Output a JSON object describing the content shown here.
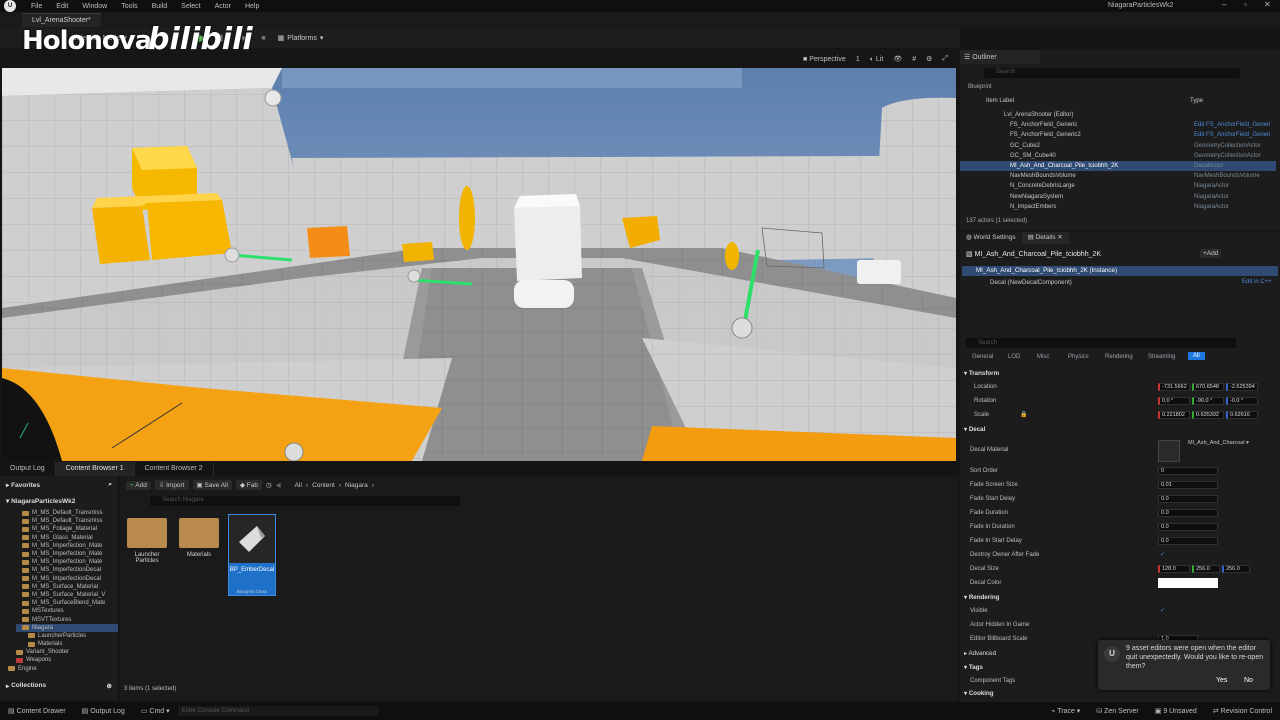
{
  "menubar": {
    "items": [
      "File",
      "Edit",
      "Window",
      "Tools",
      "Build",
      "Select",
      "Actor",
      "Help"
    ],
    "app_title": "NiagaraParticlesWk2"
  },
  "doc_tab": "Lvl_ArenaShooter*",
  "watermark": {
    "text1": "Holonova",
    "text2": "bilibili"
  },
  "toolbar": {
    "selection_mode": "Selection Mode",
    "platforms": "Platforms"
  },
  "viewport_bar": {
    "perspective": "Perspective",
    "lit": "Lit",
    "num": "1"
  },
  "lower_tabs": [
    "Output Log",
    "Content Browser 1",
    "Content Browser 2"
  ],
  "content_browser": {
    "add": "Add",
    "import": "Import",
    "save_all": "Save All",
    "fab": "Fab",
    "path": [
      "All",
      "Content",
      "Niagara"
    ],
    "search_placeholder": "Search Niagara",
    "favorites": "Favorites",
    "project": "NiagaraParticlesWk2",
    "tree": [
      "M_MS_Default_Transmiss",
      "M_MS_Default_Transmiss",
      "M_MS_Foliage_Material",
      "M_MS_Glass_Material",
      "M_MS_Imperfection_Mate",
      "M_MS_Imperfection_Mate",
      "M_MS_Imperfection_Mate",
      "M_MS_ImperfectionDecal",
      "M_MS_ImperfectionDecal",
      "M_MS_Surface_Material",
      "M_MS_Surface_Material_V",
      "M_MS_SurfaceBlend_Mate",
      "MSTextures",
      "MSVTTextures",
      "Niagara",
      "LauncherParticles",
      "Materials",
      "Variant_Shooter",
      "Weapons",
      "Engine"
    ],
    "collections": "Collections",
    "assets": [
      {
        "name": "Launcher Particles",
        "kind": "folder"
      },
      {
        "name": "Materials",
        "kind": "folder"
      },
      {
        "name": "BP_EmberDecal",
        "kind": "blueprint",
        "subtitle": "Blueprint Class"
      }
    ],
    "item_count": "3 items (1 selected)"
  },
  "statusbar": {
    "content_drawer": "Content Drawer",
    "output_log": "Output Log",
    "cmd": "Cmd",
    "console_placeholder": "Enter Console Command",
    "trace": "Trace",
    "zen": "Zen Server",
    "unsaved": "9 Unsaved",
    "revision": "Revision Control"
  },
  "outliner": {
    "title": "Outliner",
    "search_placeholder": "Search",
    "filter_label": "Blueprint",
    "col_label": "Item Label",
    "col_type": "Type",
    "rows": [
      {
        "label": "Lvl_ArenaShooter (Editor)",
        "type": ""
      },
      {
        "label": "FS_AnchorField_Generic",
        "type": "Edit FS_AnchorField_Generi"
      },
      {
        "label": "FS_AnchorField_Generic2",
        "type": "Edit FS_AnchorField_Generi"
      },
      {
        "label": "GC_Cube2",
        "type": "GeometryCollectionActor"
      },
      {
        "label": "GC_SM_Cube40",
        "type": "GeometryCollectionActor"
      },
      {
        "label": "MI_Ash_And_Charcoal_Pile_tciobhh_2K",
        "type": "DecalActor"
      },
      {
        "label": "NavMeshBoundsVolume",
        "type": "NavMeshBoundsVolume"
      },
      {
        "label": "N_ConcreteDebrisLarge",
        "type": "NiagaraActor"
      },
      {
        "label": "NewNiagaraSystem",
        "type": "NiagaraActor"
      },
      {
        "label": "N_ImpactEmbers",
        "type": "NiagaraActor"
      }
    ],
    "selected_index": 5,
    "count": "137 actors (1 selected)"
  },
  "details": {
    "tab_world": "World Settings",
    "tab_details": "Details",
    "actor_name": "MI_Ash_And_Charcoal_Pile_tciobhh_2K",
    "add": "Add",
    "instance": "MI_Ash_And_Charcoal_Pile_tciobhh_2K (Instance)",
    "component": "Decal (NewDecalComponent)",
    "edit_cpp": "Edit in C++",
    "search_placeholder": "Search",
    "categories": [
      "General",
      "LOD",
      "Misc",
      "Physics",
      "Rendering",
      "Streaming",
      "All"
    ],
    "transform": "Transform",
    "location": {
      "label": "Location",
      "values": [
        "-731.5662",
        "670.6548",
        "-2.625394"
      ]
    },
    "rotation": {
      "label": "Rotation",
      "values": [
        "0.0 °",
        "-90.0 °",
        "-0.0 °"
      ]
    },
    "scale": {
      "label": "Scale",
      "values": [
        "0.221802",
        "0.635392",
        "0.62616"
      ]
    },
    "decal": "Decal",
    "decal_material": {
      "label": "Decal Material",
      "value": "MI_Ash_And_Charcoal"
    },
    "props": [
      {
        "label": "Sort Order",
        "value": "0"
      },
      {
        "label": "Fade Screen Size",
        "value": "0.01"
      },
      {
        "label": "Fade Start Delay",
        "value": "0.0"
      },
      {
        "label": "Fade Duration",
        "value": "0.0"
      },
      {
        "label": "Fade In Duration",
        "value": "0.0"
      },
      {
        "label": "Fade In Start Delay",
        "value": "0.0"
      }
    ],
    "destroy_owner": "Destroy Owner After Fade",
    "decal_size": {
      "label": "Decal Size",
      "values": [
        "128.0",
        "256.0",
        "256.0"
      ]
    },
    "decal_color": "Decal Color",
    "rendering": "Rendering",
    "visible": "Visible",
    "hidden_in_game": "Actor Hidden In Game",
    "billboard": {
      "label": "Editor Billboard Scale",
      "value": "1.0"
    },
    "advanced": "Advanced",
    "tags": "Tags",
    "component_tags": "Component Tags",
    "cooking": "Cooking"
  },
  "toast": {
    "message": "9 asset editors were open when the editor quit unexpectedly. Would you like to re-open them?",
    "yes": "Yes",
    "no": "No"
  }
}
